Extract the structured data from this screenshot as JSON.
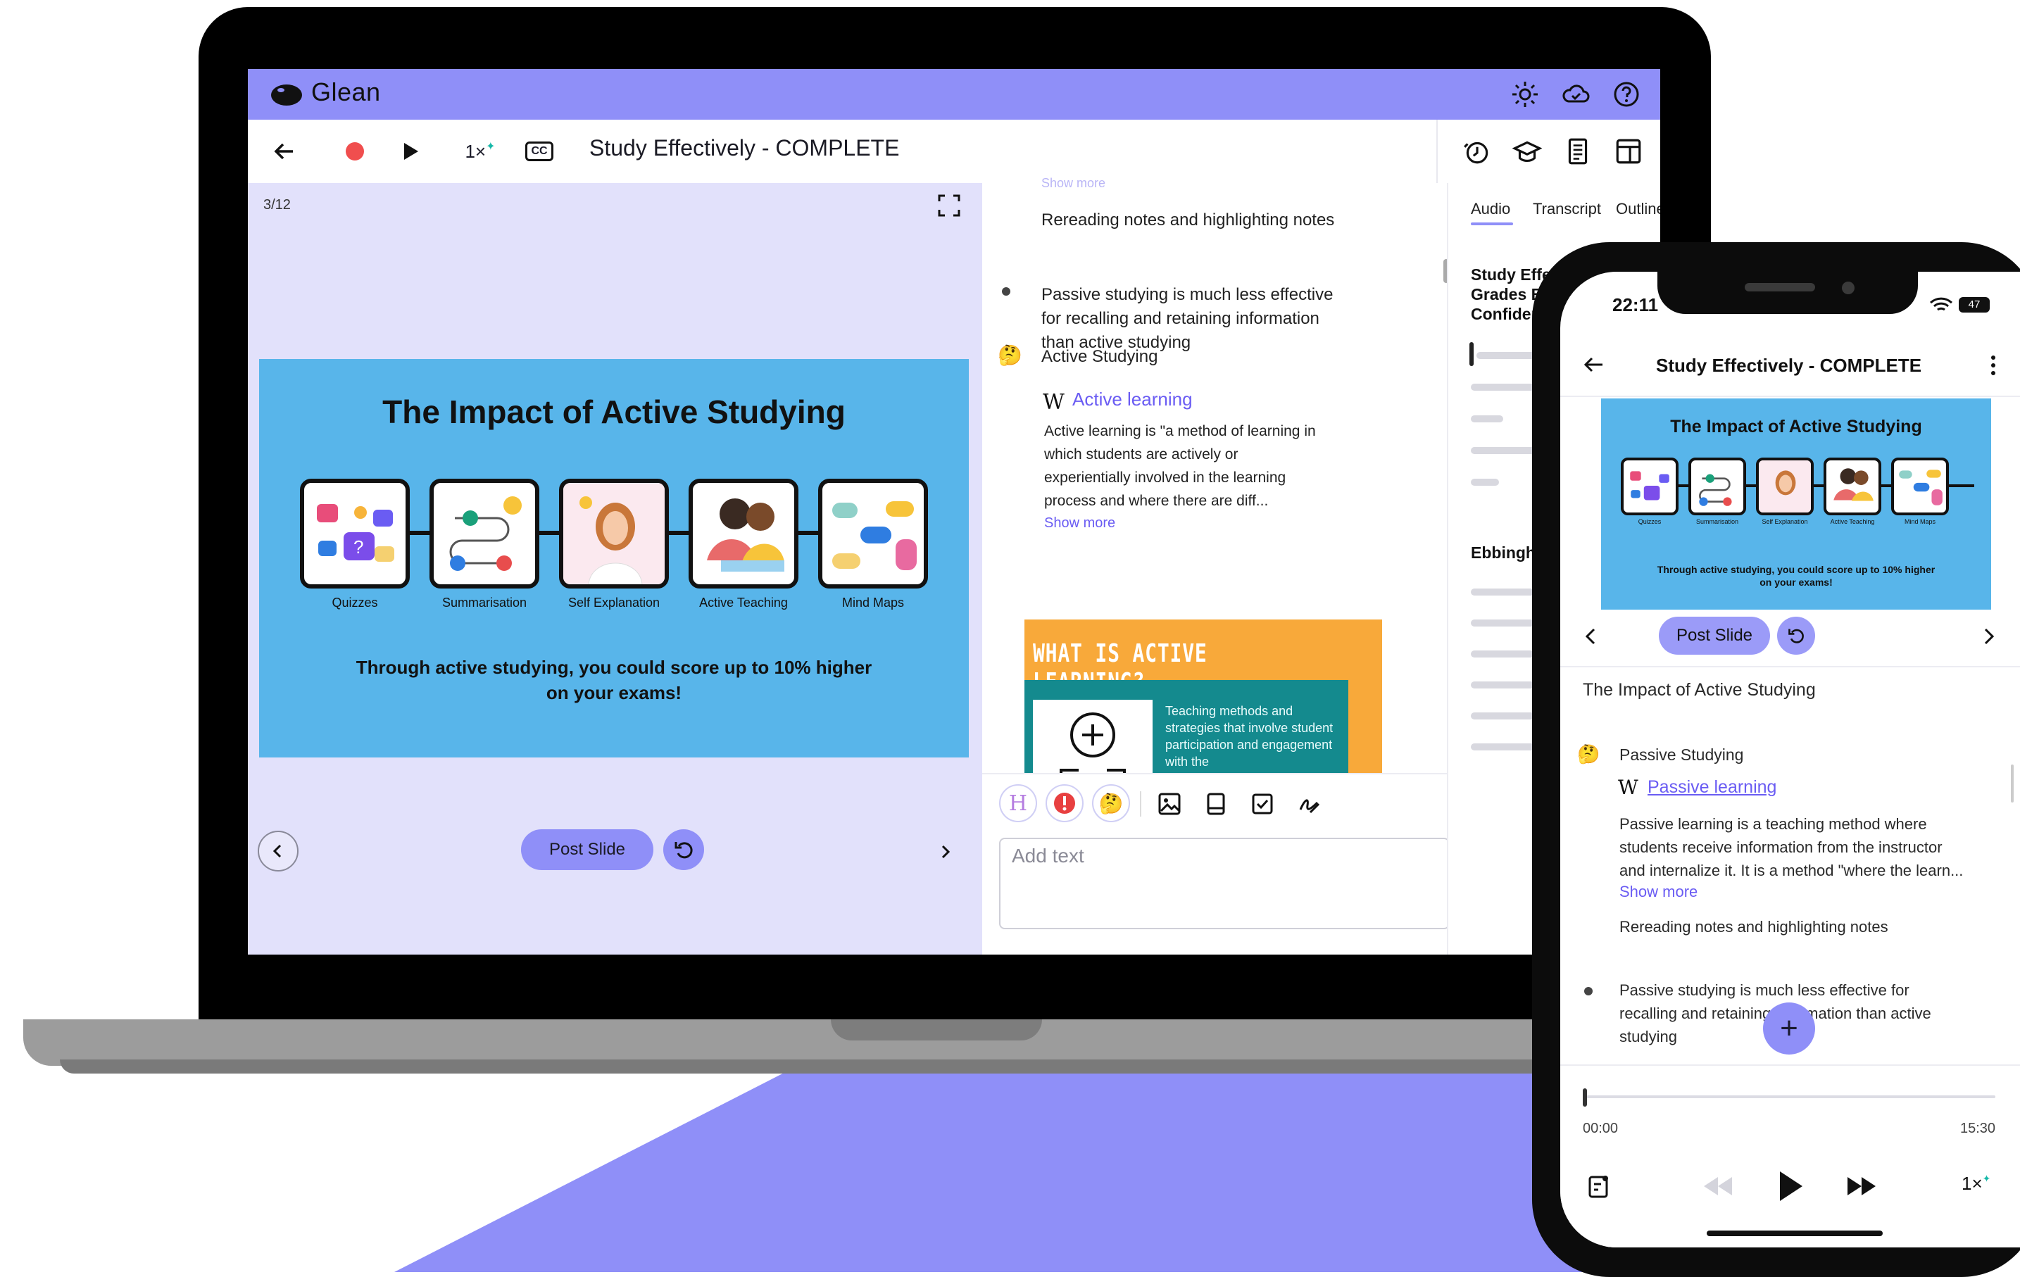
{
  "app": {
    "brand": "Glean",
    "accent_color": "#8f8ff8",
    "header_icons": [
      "sun-icon",
      "cloud-icon",
      "help-icon"
    ]
  },
  "toolbar": {
    "speed": "1×",
    "cc_label": "CC",
    "title": "Study Effectively - COMPLETE",
    "right_icons": [
      "timer-icon",
      "graduation-cap-icon",
      "document-icon",
      "layout-icon"
    ]
  },
  "slide_pane": {
    "counter": "3/12",
    "slide": {
      "title": "The Impact of Active Studying",
      "cards": [
        "Quizzes",
        "Summarisation",
        "Self Explanation",
        "Active Teaching",
        "Mind Maps"
      ],
      "footer_line1": "Through active studying, you could score up to 10% higher",
      "footer_line2": "on your exams!"
    },
    "post_slide": "Post Slide"
  },
  "notes": {
    "top_cut": "Show more",
    "item1": "Rereading notes and highlighting notes",
    "item2_line1": "Passive studying is much less effective",
    "item2_line2": "for recalling and retaining information",
    "item2_line3": "than active studying",
    "heading": "Active Studying",
    "wiki_title": "Active learning",
    "wiki_line1": "Active learning is \"a method of learning in",
    "wiki_line2": "which students are actively or",
    "wiki_line3": "experientially involved in the learning",
    "wiki_line4": "process and where there are diff...",
    "show_more": "Show more",
    "card_title": "WHAT IS ACTIVE LEARNING?",
    "card_text": "Teaching methods and strategies that involve student participation and engagement with the",
    "format_buttons": [
      "H"
    ],
    "add_text_placeholder": "Add text"
  },
  "sidebar": {
    "tabs": [
      "Audio",
      "Transcript",
      "Outline"
    ],
    "active_tab": "Audio",
    "title_line1": "Study Effecti",
    "title_line2": "Grades Boo",
    "title_line3": "Confidence",
    "heading2": "Ebbinghau"
  },
  "phone": {
    "time": "22:11",
    "battery": "47",
    "title": "Study Effectively - COMPLETE",
    "slide": {
      "title": "The Impact of Active Studying",
      "cards": [
        "Quizzes",
        "Summarisation",
        "Self Explanation",
        "Active Teaching",
        "Mind Maps"
      ],
      "footer_line1": "Through active studying, you could score up to 10% higher",
      "footer_line2": "on your exams!"
    },
    "post_slide": "Post Slide",
    "section_title": "The Impact of Active Studying",
    "heading": "Passive Studying",
    "wiki_title": "Passive learning",
    "wiki_line1": "Passive learning is a teaching method where",
    "wiki_line2": "students receive information from the instructor",
    "wiki_line3": "and internalize it. It is a method \"where the learn...",
    "show_more": "Show more",
    "item1": "Rereading notes and highlighting notes",
    "item2_line1": "Passive studying is much less effective for",
    "item2_line2": "recalling and retaining information than active",
    "item2_line3": "studying",
    "time_start": "00:00",
    "time_end": "15:30",
    "speed": "1×",
    "progress": 0.0
  }
}
